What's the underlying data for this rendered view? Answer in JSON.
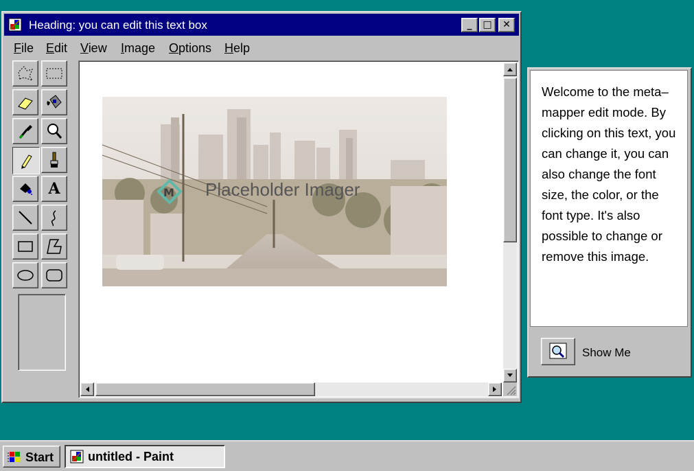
{
  "window": {
    "title": "Heading: you can edit this text box",
    "controls": {
      "minimize": "_",
      "maximize": "□",
      "close": "✕"
    }
  },
  "menu": [
    {
      "label": "File"
    },
    {
      "label": "Edit"
    },
    {
      "label": "View"
    },
    {
      "label": "Image"
    },
    {
      "label": "Options"
    },
    {
      "label": "Help"
    }
  ],
  "tools": [
    {
      "name": "free-form-select",
      "icon": "free-form-select-icon"
    },
    {
      "name": "select",
      "icon": "rect-select-icon"
    },
    {
      "name": "eraser",
      "icon": "eraser-icon"
    },
    {
      "name": "fill",
      "icon": "fill-bucket-icon"
    },
    {
      "name": "pick-color",
      "icon": "eyedropper-icon"
    },
    {
      "name": "magnifier",
      "icon": "magnifier-icon"
    },
    {
      "name": "pencil",
      "icon": "pencil-icon",
      "selected": true
    },
    {
      "name": "brush",
      "icon": "brush-icon"
    },
    {
      "name": "airbrush",
      "icon": "airbrush-icon"
    },
    {
      "name": "text",
      "icon": "text-icon",
      "glyph": "A"
    },
    {
      "name": "line",
      "icon": "line-icon"
    },
    {
      "name": "curve",
      "icon": "curve-icon"
    },
    {
      "name": "rectangle",
      "icon": "rectangle-icon"
    },
    {
      "name": "polygon",
      "icon": "polygon-icon"
    },
    {
      "name": "ellipse",
      "icon": "ellipse-icon"
    },
    {
      "name": "rounded-rectangle",
      "icon": "rounded-rectangle-icon"
    }
  ],
  "canvas": {
    "image_label": "Placeholder Imager"
  },
  "help_panel": {
    "text": "Welcome to the meta–mapper edit mode. By clicking on this text, you can change it, you can also change the font size, the color, or the font type. It's also possible to change or remove this image.",
    "show_me_label": "Show Me"
  },
  "taskbar": {
    "start_label": "Start",
    "tasks": [
      {
        "label": "untitled - Paint",
        "active": true
      }
    ]
  },
  "colors": {
    "desktop": "#008080",
    "title_bar": "#000080",
    "face": "#c0c0c0"
  }
}
